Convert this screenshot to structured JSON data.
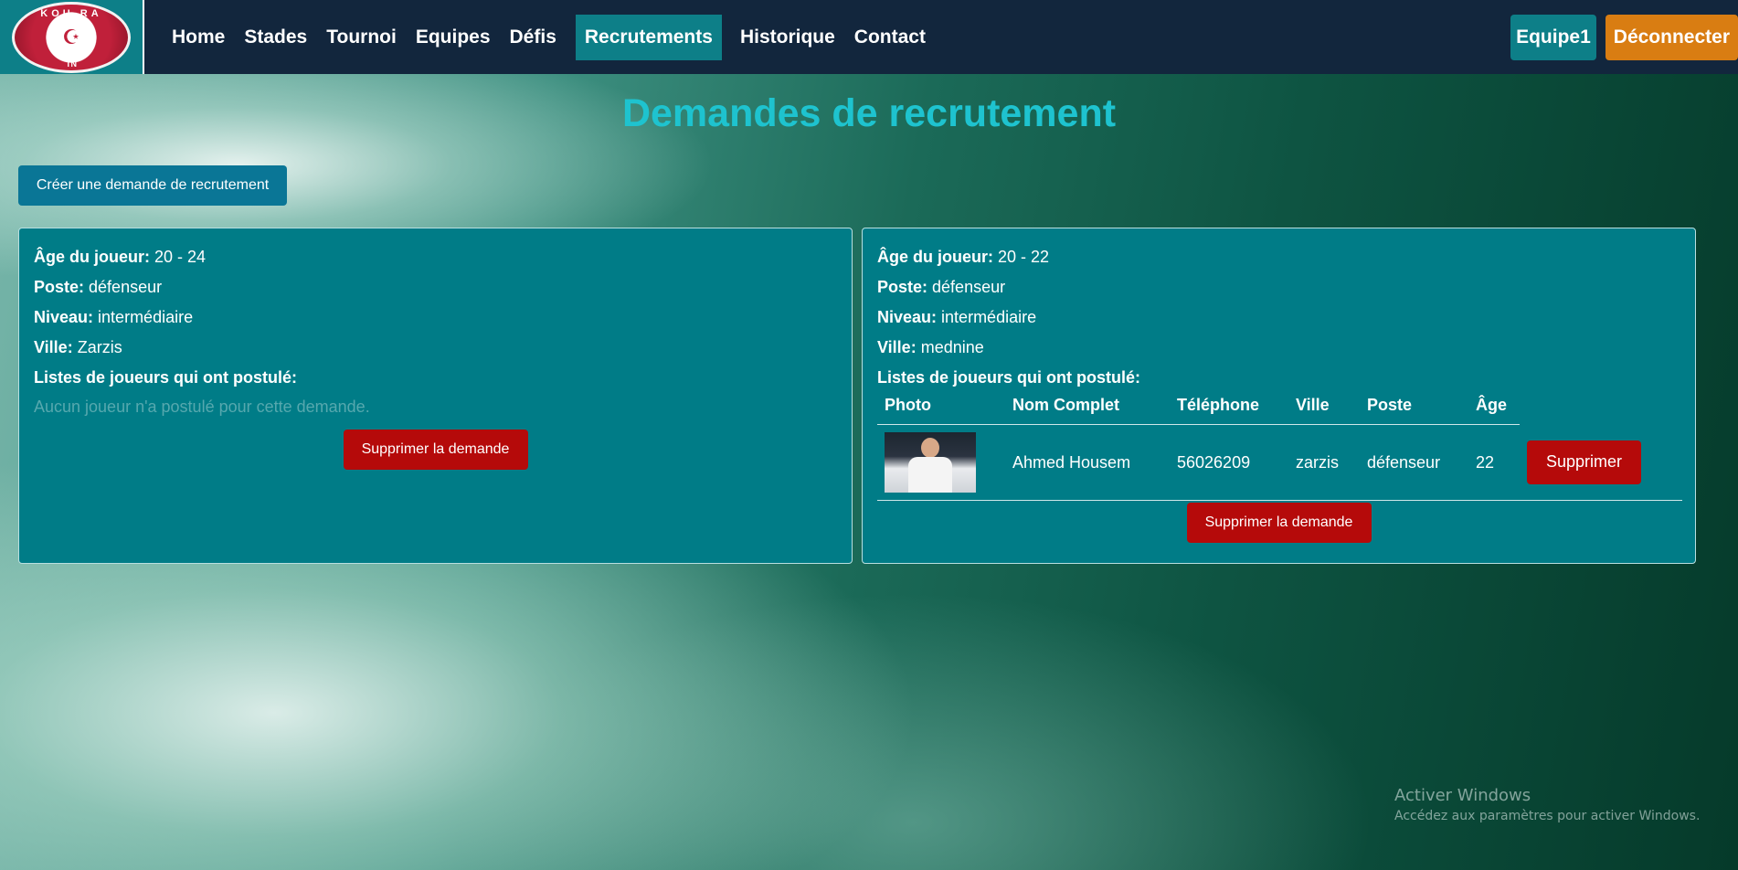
{
  "logo": {
    "top_text": "KOU RA",
    "bottom_text": "TN"
  },
  "nav": {
    "items": [
      "Home",
      "Stades",
      "Tournoi",
      "Equipes",
      "Défis",
      "Recrutements",
      "Historique",
      "Contact"
    ],
    "active": "Recrutements",
    "team_label": "Equipe1",
    "logout_label": "Déconnecter"
  },
  "page": {
    "title": "Demandes de recrutement",
    "create_label": "Créer une demande de recrutement"
  },
  "labels": {
    "age": "Âge du joueur:",
    "poste": "Poste:",
    "niveau": "Niveau:",
    "ville": "Ville:",
    "applicants": "Listes de joueurs qui ont postulé:",
    "empty": "Aucun joueur n'a postulé pour cette demande.",
    "delete_request": "Supprimer la demande",
    "delete_player": "Supprimer"
  },
  "requests": [
    {
      "age": "20 - 24",
      "poste": "défenseur",
      "niveau": "intermédiaire",
      "ville": "Zarzis"
    },
    {
      "age": "20 - 22",
      "poste": "défenseur",
      "niveau": "intermédiaire",
      "ville": "mednine"
    }
  ],
  "applicants_table": {
    "headers": [
      "Photo",
      "Nom Complet",
      "Téléphone",
      "Ville",
      "Poste",
      "Âge"
    ],
    "rows": [
      {
        "name": "Ahmed Housem",
        "phone": "56026209",
        "ville": "zarzis",
        "poste": "défenseur",
        "age": "22"
      }
    ]
  },
  "watermark": {
    "title": "Activer Windows",
    "subtitle": "Accédez aux paramètres pour activer Windows."
  }
}
